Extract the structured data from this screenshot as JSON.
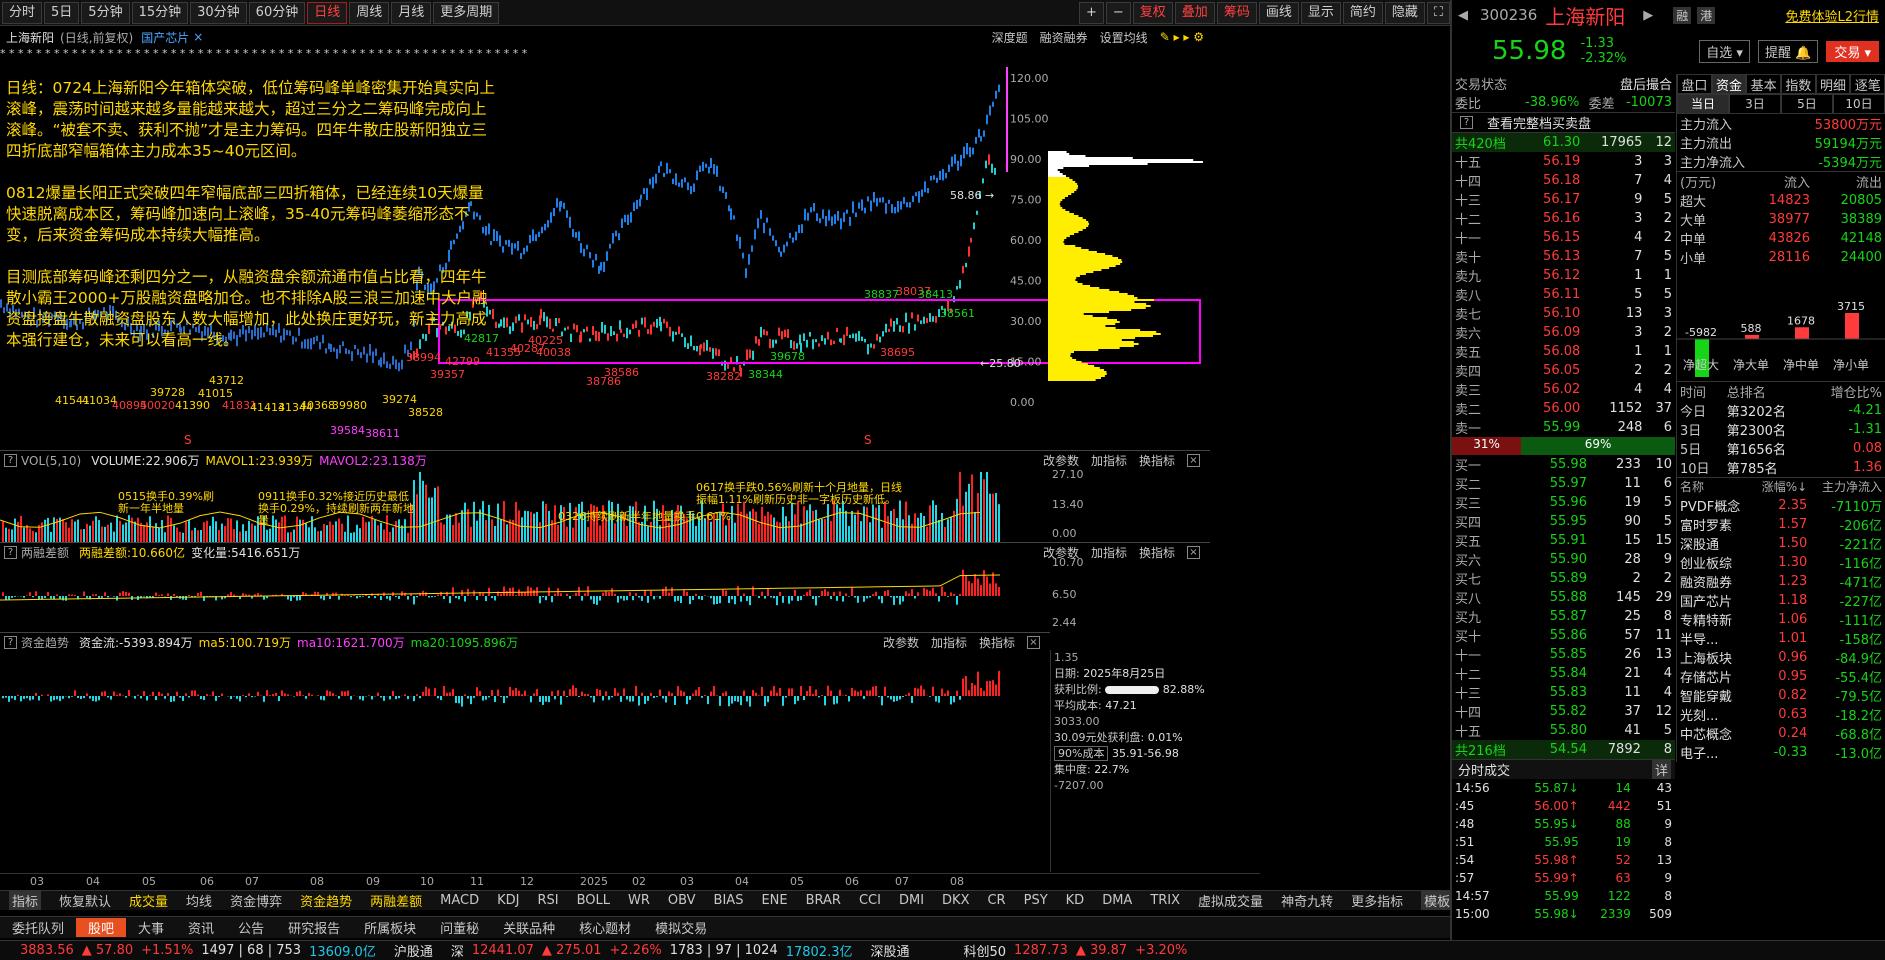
{
  "toolbar": {
    "periods": [
      "分时",
      "5日",
      "5分钟",
      "15分钟",
      "30分钟",
      "60分钟",
      "日线",
      "周线",
      "月线",
      "更多周期"
    ],
    "active_period": "日线",
    "right_buttons": [
      "+",
      "−",
      "复权",
      "叠加",
      "筹码",
      "画线",
      "显示",
      "简约",
      "隐藏"
    ]
  },
  "chart_header": {
    "stock": "上海新阳",
    "mode": "(日线,前复权)",
    "concept": "国产芯片",
    "links": [
      "深度题",
      "融资融券",
      "设置均线"
    ]
  },
  "star_markers": "*  *  *  * * *   * *  *  *  *  *   *  *  *  *   *  *  *  *  *   *  *  *  *  *   *  *  *  *  *   *  *  *  *  *   *  *  *   *  *  * *  *  *  *  *  *  *  *  *   *  *  * *  *  *  *  *",
  "annotation": [
    "日线：0724上海新阳今年箱体突破，低位筹码峰单峰密集开始真实向上滚峰，震荡时间越来越多量能越来越大，超过三分之二筹码峰完成向上滚峰。“被套不卖、获利不抛”才是主力筹码。四年牛散庄股新阳独立三四折底部窄幅箱体主力成本35~40元区间。",
    "0812爆量长阳正式突破四年窄幅底部三四折箱体，已经连续10天爆量快速脱离成本区，筹码峰加速向上滚峰，35-40元筹码峰萎缩形态不变，后来资金筹码成本持续大幅推高。",
    "目测底部筹码峰还剩四分之一，从融资盘余额流通市值占比看，四年牛散小霸王2000+万股融资盘略加仓。也不排除A股三浪三加速中大户融资盘接盘牛散融资盘股东人数大幅增加，此处换庄更好玩，新主力高成本强行建仓，未来可以看高一线。"
  ],
  "price_axis": [
    "120.00",
    "105.00",
    "90.00",
    "75.00",
    "60.00",
    "45.00",
    "30.00",
    "15.00",
    "0.00"
  ],
  "chart_labels": [
    {
      "t": "58.86 →",
      "c": "w"
    },
    {
      "t": "←25.80",
      "c": "w"
    },
    {
      "t": "38837",
      "c": "g"
    },
    {
      "t": "38037",
      "c": "r"
    },
    {
      "t": "38413",
      "c": "g"
    },
    {
      "t": "38561",
      "c": "g"
    },
    {
      "t": "38695",
      "c": "r"
    },
    {
      "t": "42817",
      "c": "g"
    },
    {
      "t": "41355",
      "c": "r"
    },
    {
      "t": "40225",
      "c": "r"
    },
    {
      "t": "40287",
      "c": "r"
    },
    {
      "t": "40038",
      "c": "r"
    },
    {
      "t": "38786",
      "c": "r"
    },
    {
      "t": "38586",
      "c": "r"
    },
    {
      "t": "38282",
      "c": "r"
    },
    {
      "t": "38344",
      "c": "g"
    },
    {
      "t": "39678",
      "c": "g"
    },
    {
      "t": "39357",
      "c": "r"
    },
    {
      "t": "42799",
      "c": "r"
    },
    {
      "t": "38528",
      "c": "y"
    },
    {
      "t": "38994",
      "c": "r"
    },
    {
      "t": "39584",
      "c": "m"
    },
    {
      "t": "38611",
      "c": "m"
    },
    {
      "t": "39274",
      "c": "y"
    },
    {
      "t": "39980",
      "c": "y"
    },
    {
      "t": "41541",
      "c": "y"
    },
    {
      "t": "41034",
      "c": "y"
    },
    {
      "t": "40895",
      "c": "r"
    },
    {
      "t": "40020",
      "c": "r"
    },
    {
      "t": "39728",
      "c": "y"
    },
    {
      "t": "41390",
      "c": "y"
    },
    {
      "t": "41015",
      "c": "y"
    },
    {
      "t": "41831",
      "c": "r"
    },
    {
      "t": "41413",
      "c": "y"
    },
    {
      "t": "41344",
      "c": "y"
    },
    {
      "t": "40368",
      "c": "y"
    },
    {
      "t": "43712",
      "c": "y"
    }
  ],
  "vol_panel": {
    "title": "VOL(5,10)",
    "volume": "VOLUME:22.906万",
    "ma1": "MAVOL1:23.939万",
    "ma2": "MAVOL2:23.138万",
    "axis": [
      "27.10",
      "13.40",
      "0.00"
    ],
    "notes": [
      "0515换手0.39%刷新一年半地量",
      "0911换手0.32%接近历史最低换手0.29%，持续刷新两年新地量",
      "0326持续刷新半年地量换手0.61%",
      "0617换手跌0.56%刷新十个月地量，日线振幅1.11%刷新历史非一字板历史新低。"
    ]
  },
  "margin_panel": {
    "title": "两融差额",
    "value": "两融差额:10.660亿",
    "change": "变化量:5416.651万",
    "axis": [
      "10.70",
      "6.50",
      "2.44"
    ]
  },
  "fund_panel": {
    "title": "资金趋势",
    "flow": "资金流:-5393.894万",
    "ma5": "ma5:100.719万",
    "ma10": "ma10:1621.700万",
    "ma20": "ma20:1095.896万",
    "axis": [
      "1.35",
      "3033.00",
      "-7207.00"
    ]
  },
  "panel_links": [
    "改参数",
    "加指标",
    "换指标"
  ],
  "chip_info": {
    "date_label": "日期:",
    "date": "2025年8月25日",
    "profit_label": "获利比例:",
    "profit": "82.88%",
    "avg_label": "平均成本:",
    "avg": "47.21",
    "at_price": "30.09元处获利盘:",
    "at_price_val": "0.01%",
    "cost_select": "90%成本",
    "cost_range": "35.91-56.98",
    "conc_label": "集中度:",
    "conc": "22.7%"
  },
  "x_axis": [
    "03",
    "04",
    "05",
    "06",
    "07",
    "08",
    "09",
    "10",
    "11",
    "12",
    "2025",
    "02",
    "03",
    "04",
    "05",
    "06",
    "07",
    "08"
  ],
  "indicator_tabs": [
    "指标",
    "恢复默认",
    "成交量",
    "均线",
    "资金博弈",
    "资金趋势",
    "两融差额",
    "MACD",
    "KDJ",
    "RSI",
    "BOLL",
    "WR",
    "OBV",
    "BIAS",
    "ENE",
    "BRAR",
    "CCI",
    "DMI",
    "DKX",
    "CR",
    "PSY",
    "KD",
    "DMA",
    "TRIX",
    "虚拟成交量",
    "神奇九转",
    "更多指标",
    "模板"
  ],
  "bottom_tabs": [
    "委托队列",
    "股吧",
    "大事",
    "资讯",
    "公告",
    "研究报告",
    "所属板块",
    "问董秘",
    "关联品种",
    "核心题材",
    "模拟交易"
  ],
  "status_bar": {
    "sh_index": "3883.56",
    "sh_chg": "▲ 57.80",
    "sh_pct": "+1.51%",
    "sh_updown": "1497 | 68 | 753",
    "sh_amt": "13609.0亿",
    "hgt": "沪股通",
    "sz_label": "深",
    "sz_index": "12441.07",
    "sz_chg": "▲ 275.01",
    "sz_pct": "+2.26%",
    "sz_updown": "1783 | 97 | 1024",
    "sz_amt": "17802.3亿",
    "sgt": "深股通",
    "kc_label": "科创50",
    "kc_index": "1287.73",
    "kc_chg": "▲ 39.87",
    "kc_pct": "+3.20%"
  },
  "quote": {
    "code": "300236",
    "name": "上海新阳",
    "badges": [
      "融",
      "港"
    ],
    "trial": "免费体验L2行情",
    "price": "55.98",
    "change": "-1.33",
    "pct": "-2.32%",
    "buttons": [
      "自选",
      "提醒",
      "交易"
    ],
    "state_label": "交易状态",
    "state": "盘后撮合",
    "weibi_label": "委比",
    "weibi": "-38.96%",
    "weicha_label": "委差",
    "weicha": "-10073",
    "full_btn": "查看完整档买卖盘",
    "total_ask": [
      "共420档",
      "61.30",
      "17965",
      "12"
    ],
    "asks": [
      [
        "十五",
        "56.19",
        "3",
        "3"
      ],
      [
        "十四",
        "56.18",
        "7",
        "4"
      ],
      [
        "十三",
        "56.17",
        "9",
        "5"
      ],
      [
        "十二",
        "56.16",
        "3",
        "2"
      ],
      [
        "十一",
        "56.15",
        "4",
        "2"
      ],
      [
        "卖十",
        "56.13",
        "7",
        "5"
      ],
      [
        "卖九",
        "56.12",
        "1",
        "1"
      ],
      [
        "卖八",
        "56.11",
        "5",
        "5"
      ],
      [
        "卖七",
        "56.10",
        "13",
        "3"
      ],
      [
        "卖六",
        "56.09",
        "3",
        "2"
      ],
      [
        "卖五",
        "56.08",
        "1",
        "1"
      ],
      [
        "卖四",
        "56.05",
        "2",
        "2"
      ],
      [
        "卖三",
        "56.02",
        "4",
        "4"
      ],
      [
        "卖二",
        "56.00",
        "1152",
        "37"
      ],
      [
        "卖一",
        "55.99",
        "248",
        "6"
      ]
    ],
    "ratio_sell": "31%",
    "ratio_buy": "69%",
    "bids": [
      [
        "买一",
        "55.98",
        "233",
        "10"
      ],
      [
        "买二",
        "55.97",
        "11",
        "6"
      ],
      [
        "买三",
        "55.96",
        "19",
        "5"
      ],
      [
        "买四",
        "55.95",
        "90",
        "5"
      ],
      [
        "买五",
        "55.91",
        "15",
        "15"
      ],
      [
        "买六",
        "55.90",
        "28",
        "9"
      ],
      [
        "买七",
        "55.89",
        "2",
        "2"
      ],
      [
        "买八",
        "55.88",
        "145",
        "29"
      ],
      [
        "买九",
        "55.87",
        "25",
        "8"
      ],
      [
        "买十",
        "55.86",
        "57",
        "11"
      ],
      [
        "十一",
        "55.85",
        "26",
        "13"
      ],
      [
        "十二",
        "55.84",
        "21",
        "4"
      ],
      [
        "十三",
        "55.83",
        "11",
        "4"
      ],
      [
        "十四",
        "55.82",
        "37",
        "12"
      ],
      [
        "十五",
        "55.80",
        "41",
        "5"
      ]
    ],
    "total_bid": [
      "共216档",
      "54.54",
      "7892",
      "8"
    ],
    "trades_title": "分时成交",
    "trades_btn": "详",
    "trades": [
      [
        "14:56",
        "55.87",
        "↓",
        "14",
        "43"
      ],
      [
        ":45",
        "56.00",
        "↑",
        "442",
        "51"
      ],
      [
        ":48",
        "55.95",
        "↓",
        "88",
        "9"
      ],
      [
        ":51",
        "55.95",
        "",
        "19",
        "8"
      ],
      [
        ":54",
        "55.98",
        "↑",
        "52",
        "13"
      ],
      [
        ":57",
        "55.99",
        "↑",
        "63",
        "9"
      ],
      [
        "14:57",
        "55.99",
        "",
        "122",
        "8"
      ],
      [
        "15:00",
        "55.98",
        "↓",
        "2339",
        "509"
      ]
    ]
  },
  "fund": {
    "tabs": [
      "盘口",
      "资金",
      "基本",
      "指数",
      "明细",
      "逐笔"
    ],
    "periods": [
      "当日",
      "3日",
      "5日",
      "10日"
    ],
    "main_in_label": "主力流入",
    "main_in": "53800万元",
    "main_out_label": "主力流出",
    "main_out": "59194万元",
    "main_net_label": "主力净流入",
    "main_net": "-5394万元",
    "flow_hdr": [
      "(万元)",
      "流入",
      "流出"
    ],
    "flows": [
      [
        "超大",
        "14823",
        "20805"
      ],
      [
        "大单",
        "38977",
        "38389"
      ],
      [
        "中单",
        "43826",
        "42148"
      ],
      [
        "小单",
        "28116",
        "24400"
      ]
    ],
    "bars": [
      {
        "label": "净超大",
        "value": -5982,
        "text": "-5982"
      },
      {
        "label": "净大单",
        "value": 588,
        "text": "588"
      },
      {
        "label": "净中单",
        "value": 1678,
        "text": "1678"
      },
      {
        "label": "净小单",
        "value": 3715,
        "text": "3715"
      }
    ],
    "rank_hdr": [
      "时间",
      "总排名",
      "增仓比%"
    ],
    "ranks": [
      [
        "今日",
        "第3202名",
        "-4.21"
      ],
      [
        "3日",
        "第2300名",
        "-1.31"
      ],
      [
        "5日",
        "第1656名",
        "0.08"
      ],
      [
        "10日",
        "第785名",
        "1.36"
      ]
    ],
    "sector_hdr": [
      "名称",
      "涨幅%↓",
      "主力净流入"
    ],
    "sectors": [
      [
        "PVDF概念",
        "2.35",
        "-7110万"
      ],
      [
        "富时罗素",
        "1.57",
        "-206亿"
      ],
      [
        "深股通",
        "1.50",
        "-221亿"
      ],
      [
        "创业板综",
        "1.30",
        "-116亿"
      ],
      [
        "融资融券",
        "1.23",
        "-471亿"
      ],
      [
        "国产芯片",
        "1.18",
        "-227亿"
      ],
      [
        "专精特新",
        "1.06",
        "-111亿"
      ],
      [
        "半导...",
        "1.01",
        "-158亿"
      ],
      [
        "上海板块",
        "0.96",
        "-84.9亿"
      ],
      [
        "存储芯片",
        "0.95",
        "-55.4亿"
      ],
      [
        "智能穿戴",
        "0.82",
        "-79.5亿"
      ],
      [
        "光刻...",
        "0.63",
        "-18.2亿"
      ],
      [
        "中芯概念",
        "0.24",
        "-68.8亿"
      ],
      [
        "电子...",
        "-0.33",
        "-13.0亿"
      ]
    ]
  }
}
